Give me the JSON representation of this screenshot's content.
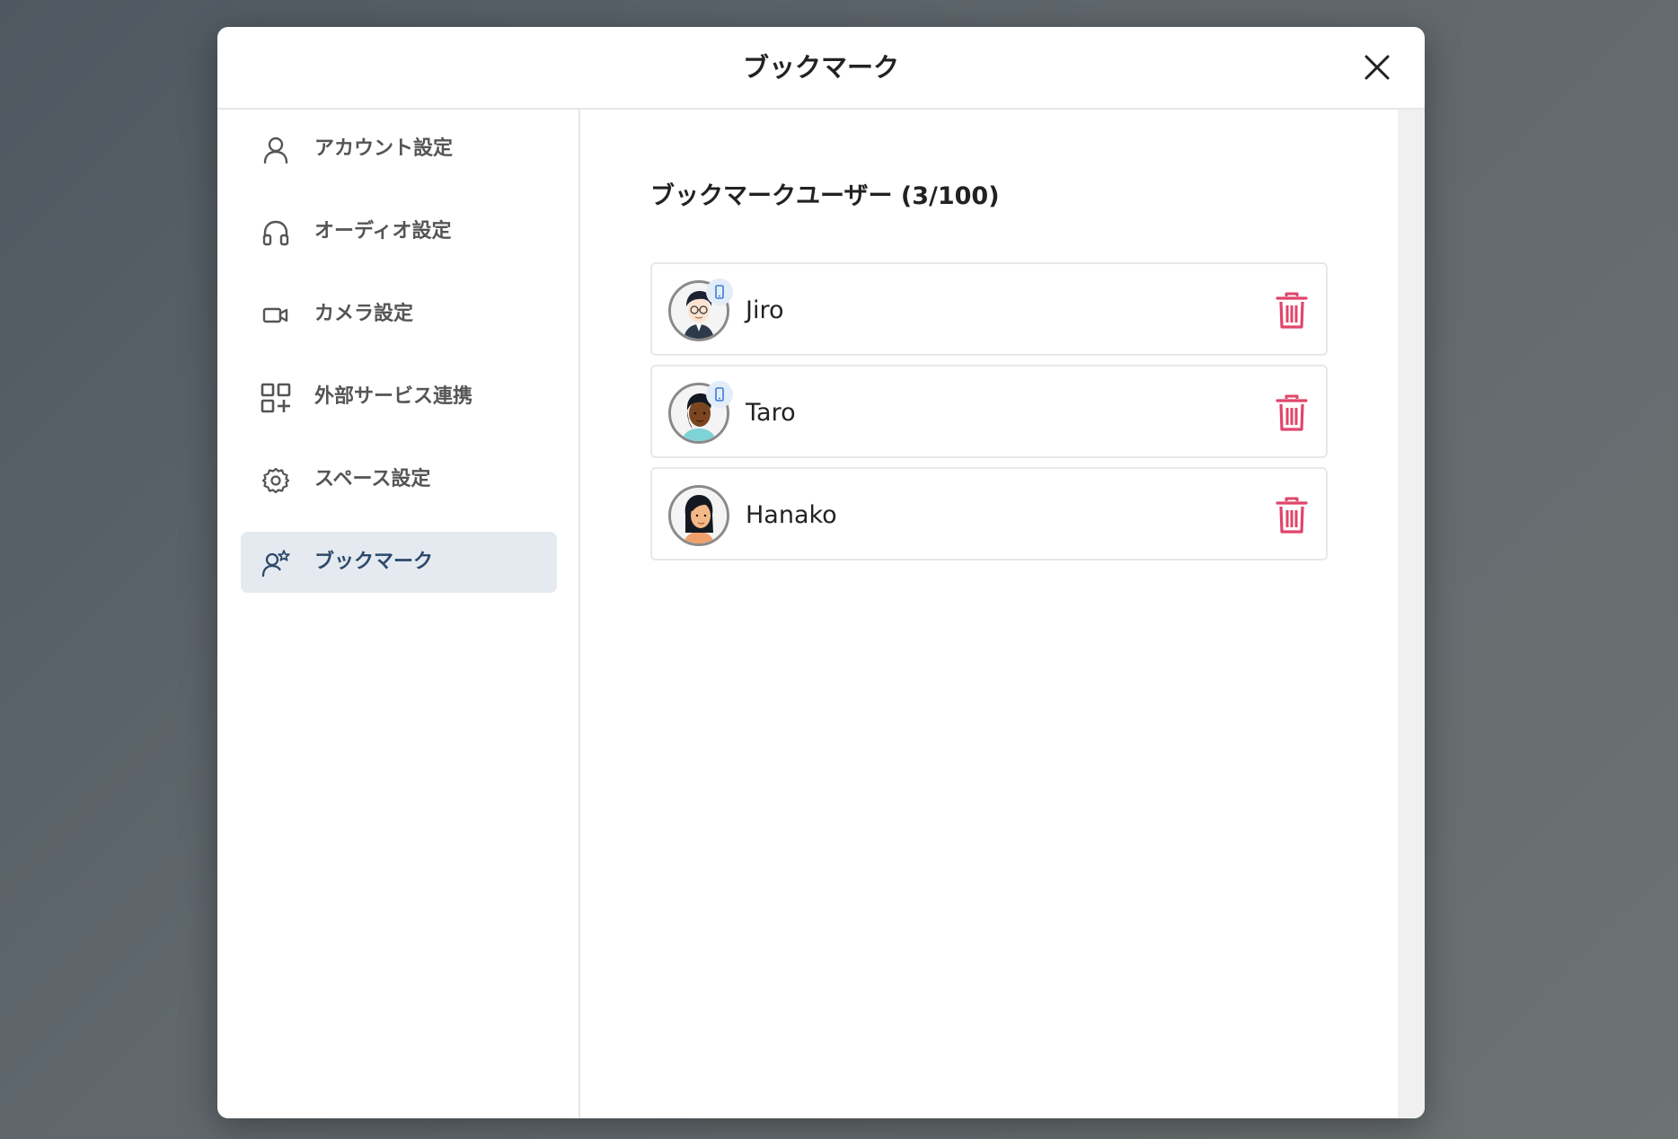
{
  "modal": {
    "title": "ブックマーク",
    "close_icon": "close-icon"
  },
  "sidebar": {
    "items": [
      {
        "label": "アカウント設定",
        "icon": "user-icon",
        "active": false
      },
      {
        "label": "オーディオ設定",
        "icon": "headphones-icon",
        "active": false
      },
      {
        "label": "カメラ設定",
        "icon": "video-camera-icon",
        "active": false
      },
      {
        "label": "外部サービス連携",
        "icon": "apps-add-icon",
        "active": false
      },
      {
        "label": "スペース設定",
        "icon": "gear-icon",
        "active": false
      },
      {
        "label": "ブックマーク",
        "icon": "user-star-icon",
        "active": true
      }
    ]
  },
  "main": {
    "section_title": "ブックマークユーザー (3/100)",
    "users": [
      {
        "name": "Jiro",
        "mobile_badge": true
      },
      {
        "name": "Taro",
        "mobile_badge": true
      },
      {
        "name": "Hanako",
        "mobile_badge": false
      }
    ]
  },
  "colors": {
    "delete": "#e0456a",
    "active_nav_bg": "#e4eaf0",
    "active_nav_text": "#2c4a6b",
    "badge_bg": "#e3edf9",
    "badge_icon": "#3b7dd8"
  }
}
